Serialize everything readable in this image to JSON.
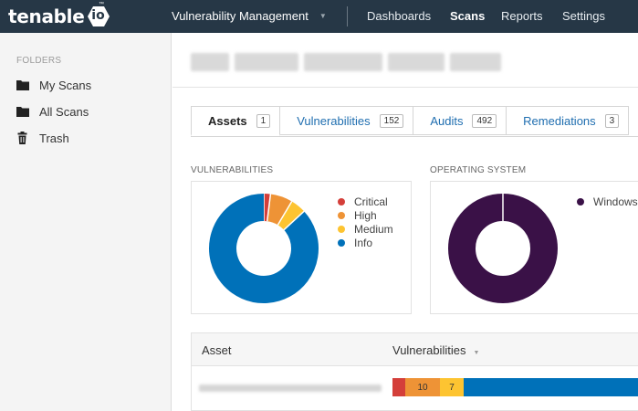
{
  "app": {
    "logo_text": "tenable",
    "logo_io": "io",
    "logo_tm": "™",
    "product": "Vulnerability Management",
    "nav": [
      {
        "label": "Dashboards",
        "active": false
      },
      {
        "label": "Scans",
        "active": true
      },
      {
        "label": "Reports",
        "active": false
      },
      {
        "label": "Settings",
        "active": false
      }
    ]
  },
  "sidebar": {
    "title": "FOLDERS",
    "items": [
      {
        "label": "My Scans",
        "icon": "folder-icon"
      },
      {
        "label": "All Scans",
        "icon": "folder-icon"
      },
      {
        "label": "Trash",
        "icon": "trash-icon"
      }
    ]
  },
  "tabs": [
    {
      "label": "Assets",
      "count": "1",
      "active": true
    },
    {
      "label": "Vulnerabilities",
      "count": "152",
      "active": false
    },
    {
      "label": "Audits",
      "count": "492",
      "active": false
    },
    {
      "label": "Remediations",
      "count": "3",
      "active": false
    }
  ],
  "vuln_widget": {
    "title": "VULNERABILITIES",
    "legend": [
      {
        "label": "Critical",
        "color": "#d43f3a"
      },
      {
        "label": "High",
        "color": "#ee9336"
      },
      {
        "label": "Medium",
        "color": "#fdc431"
      },
      {
        "label": "Info",
        "color": "#0071b9"
      }
    ],
    "values": {
      "critical": 3,
      "high": 10,
      "medium": 7,
      "info": 132
    }
  },
  "os_widget": {
    "title": "OPERATING SYSTEM",
    "legend": [
      {
        "label": "Windows",
        "color": "#3a1147"
      }
    ]
  },
  "table": {
    "columns": [
      "Asset",
      "Vulnerabilities"
    ],
    "rows": [
      {
        "segments": [
          {
            "value": 3,
            "label": "",
            "color": "#d43f3a"
          },
          {
            "value": 10,
            "label": "10",
            "color": "#ee9336"
          },
          {
            "value": 7,
            "label": "7",
            "color": "#fdc431"
          },
          {
            "value": 132,
            "label": "",
            "color": "#0071b9"
          }
        ]
      }
    ]
  }
}
